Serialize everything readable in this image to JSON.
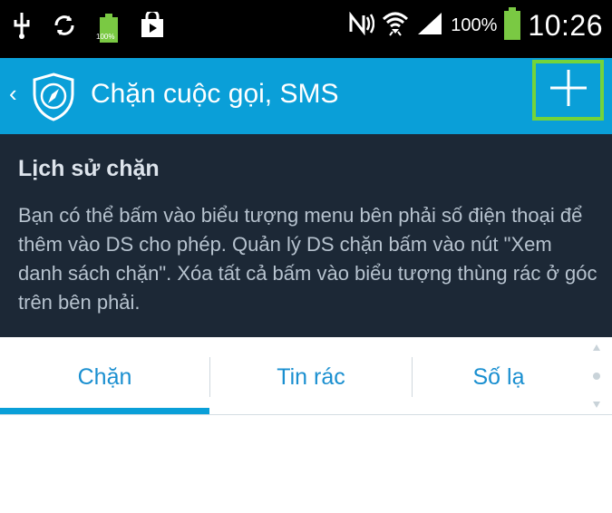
{
  "status_bar": {
    "battery_percent_small": "100%",
    "battery_percent": "100%",
    "time": "10:26"
  },
  "action_bar": {
    "title": "Chặn cuộc gọi, SMS"
  },
  "info": {
    "title": "Lịch sử chặn",
    "text": "Bạn có thể bấm vào biểu tượng menu bên phải số điện thoại để thêm vào DS cho phép. Quản lý DS chặn bấm vào nút \"Xem danh sách chặn\". Xóa tất cả bấm vào biểu tượng thùng rác ở góc trên bên phải."
  },
  "tabs": [
    {
      "label": "Chặn",
      "selected": true
    },
    {
      "label": "Tin rác",
      "selected": false
    },
    {
      "label": "Số lạ",
      "selected": false
    }
  ],
  "colors": {
    "action_bar": "#0a9fd8",
    "info_background": "#1c2836",
    "tab_text": "#1a8fd0",
    "highlight": "#74d43a"
  }
}
